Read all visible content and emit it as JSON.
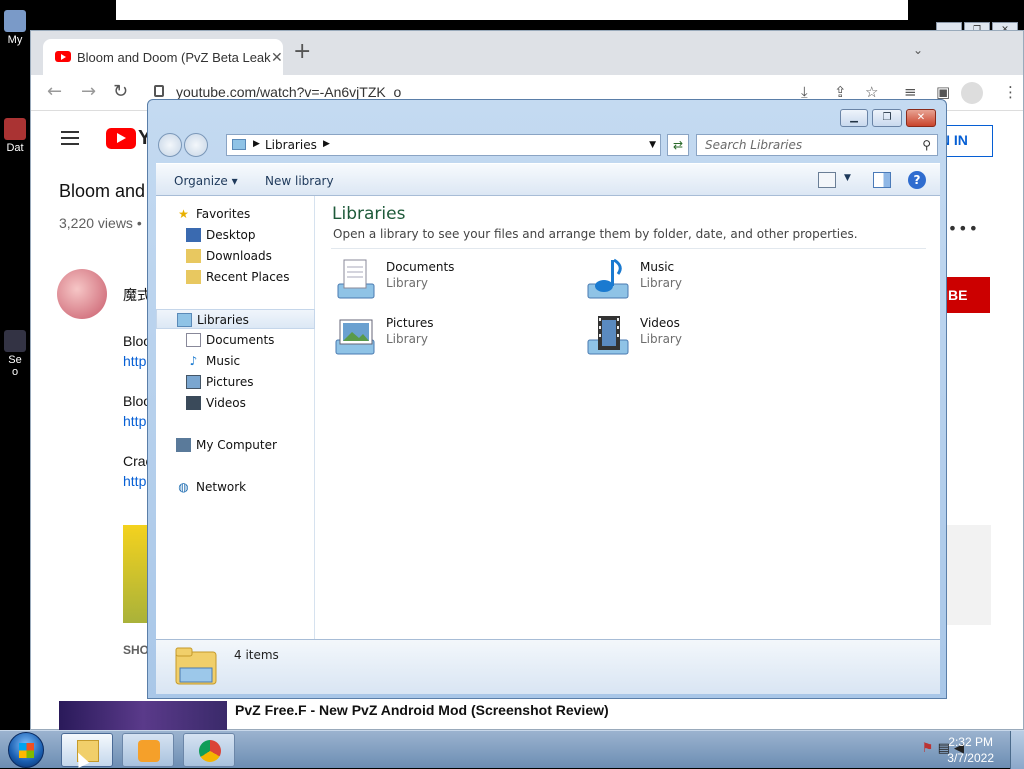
{
  "desktop": {
    "icons": [
      {
        "label": "My"
      },
      {
        "label": "Dat"
      },
      {
        "label": "Se"
      },
      {
        "label": "o"
      }
    ]
  },
  "chrome": {
    "tab_title": "Bloom and Doom (PvZ Beta Leak",
    "url": "youtube.com/watch?v=-An6vjTZK_o",
    "youtube": {
      "logo_text": "Y",
      "sign_in": "IN IN",
      "video_title": "Bloom and",
      "views": "3,220 views •",
      "channel_name": "魔式",
      "subscribe": "RIBE",
      "more": "•••",
      "description": [
        {
          "text": "Bloo",
          "link": false
        },
        {
          "text": "http",
          "link": true
        },
        {
          "text": "Bloo",
          "link": false
        },
        {
          "text": "http",
          "link": true
        },
        {
          "text": "Crac",
          "link": false
        },
        {
          "text": "http",
          "link": true
        }
      ],
      "show_more": "SHO",
      "related_title": "PvZ Free.F - New PvZ Android Mod (Screenshot Review)"
    }
  },
  "explorer": {
    "address": "Libraries",
    "search_placeholder": "Search Libraries",
    "toolbar": {
      "organize": "Organize ▾",
      "new_library": "New library"
    },
    "nav": {
      "favorites": "Favorites",
      "desktop": "Desktop",
      "downloads": "Downloads",
      "recent": "Recent Places",
      "libraries": "Libraries",
      "documents": "Documents",
      "music": "Music",
      "pictures": "Pictures",
      "videos": "Videos",
      "computer": "My Computer",
      "network": "Network"
    },
    "content": {
      "title": "Libraries",
      "subtitle": "Open a library to see your files and arrange them by folder, date, and other properties.",
      "libraries": [
        {
          "name": "Documents",
          "type": "Library"
        },
        {
          "name": "Music",
          "type": "Library"
        },
        {
          "name": "Pictures",
          "type": "Library"
        },
        {
          "name": "Videos",
          "type": "Library"
        }
      ]
    },
    "status": "4 items"
  },
  "taskbar": {
    "time": "2:32 PM",
    "date": "3/7/2022"
  }
}
